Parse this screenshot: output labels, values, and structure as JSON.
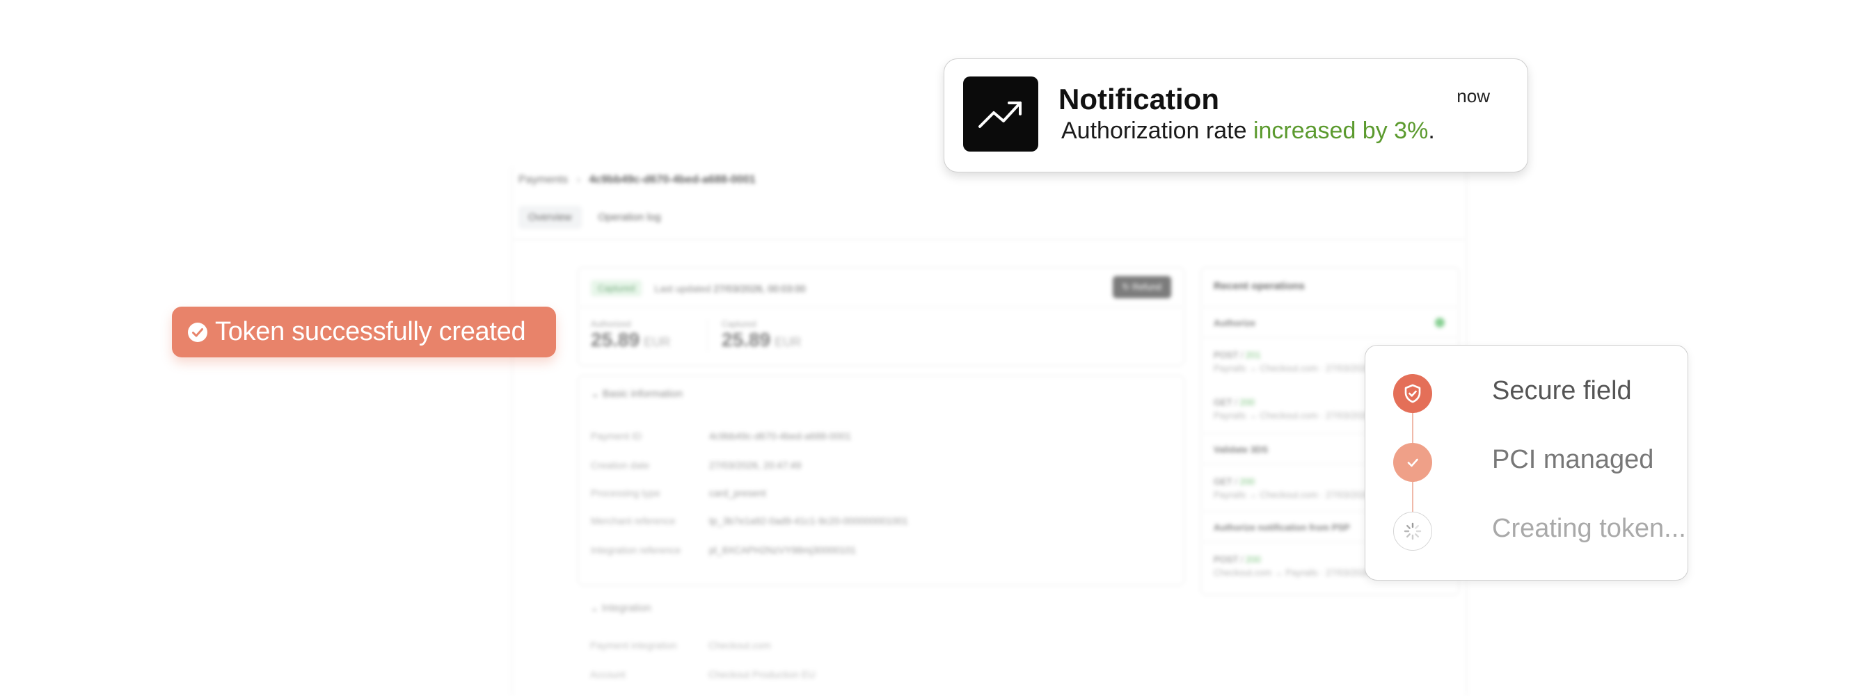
{
  "dashboard": {
    "breadcrumb": {
      "root": "Payments",
      "separator": "›",
      "current": "4c9bb49c-d670-4bed-a688-0001"
    },
    "tabs": [
      "Overview",
      "Operation log"
    ],
    "summary": {
      "status": "Captured",
      "last_updated_label": "Last updated",
      "last_updated_value": "27/03/2026, 00:03:00",
      "refund_label": "↻ Refund",
      "authorized_label": "Authorized",
      "authorized_value": "25.89",
      "authorized_currency": "EUR",
      "captured_label": "Captured",
      "captured_value": "25.89",
      "captured_currency": "EUR"
    },
    "basic_info": {
      "heading": "Basic information",
      "rows": [
        {
          "k": "Payment ID",
          "v": "4c9bb49c-d670-4bed-a688-0001"
        },
        {
          "k": "Creation date",
          "v": "27/03/2026, 20:47:49"
        },
        {
          "k": "Processing type",
          "v": "card_present"
        },
        {
          "k": "Merchant reference",
          "v": "tp_3b7e1a92-0ad9-41c1-9c20-000000001001"
        },
        {
          "k": "Integration reference",
          "v": "pl_8XCAPH2NzVY98mj30000101"
        }
      ]
    },
    "integration": {
      "heading": "Integration",
      "payment_integration_label": "Payment integration",
      "payment_integration_value": "Checkout.com",
      "account_label": "Account",
      "account_value": "Checkout Production EU"
    },
    "recent_ops": {
      "title": "Recent operations",
      "groups": [
        {
          "name": "Authorize"
        },
        {
          "method": "POST",
          "code": "201",
          "route": "Payrails → Checkout.com · 27/03/2026"
        },
        {
          "method": "GET",
          "code": "200",
          "route": "Payrails → Checkout.com · 27/03/2026"
        },
        {
          "name": "Validate 3DS"
        },
        {
          "method": "GET",
          "code": "200",
          "route": "Payrails → Checkout.com · 27/03/2026"
        },
        {
          "name": "Authorize notification from PSP"
        },
        {
          "method": "POST",
          "code": "200",
          "route": "Checkout.com → Payrails · 27/03/2026, 00:03:00"
        }
      ]
    }
  },
  "notification": {
    "icon": "trending-up-icon",
    "title": "Notification",
    "message_prefix": "Authorization rate ",
    "message_highlight": "increased by 3%",
    "message_suffix": ".",
    "time": "now",
    "highlight_color": "#5b9a2e"
  },
  "toast": {
    "icon": "check-circle-icon",
    "text": "Token successfully created",
    "color": "#e8836a"
  },
  "steps": [
    {
      "icon": "shield-check-icon",
      "label": "Secure field",
      "state": "done"
    },
    {
      "icon": "check-icon",
      "label": "PCI managed",
      "state": "done"
    },
    {
      "icon": "spinner-icon",
      "label": "Creating token...",
      "state": "in-progress"
    }
  ]
}
